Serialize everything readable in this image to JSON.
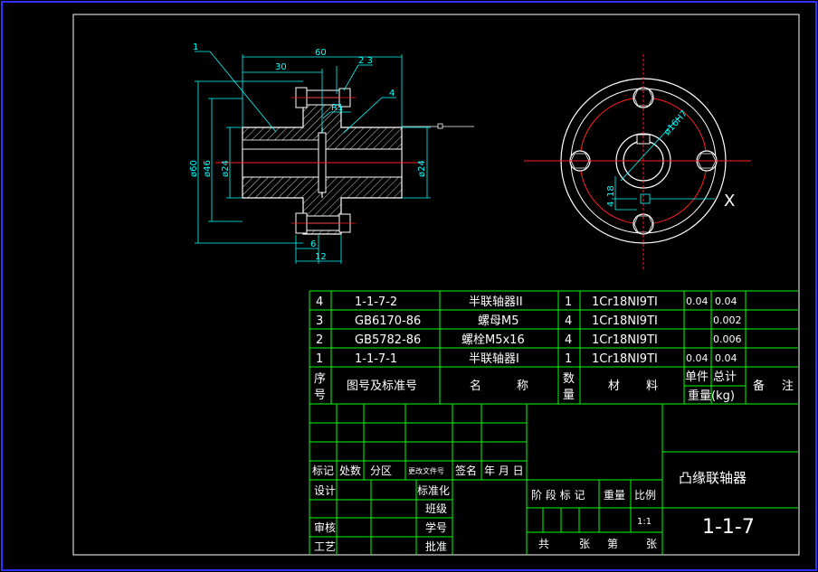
{
  "drawing": {
    "dims": {
      "leader_1": "1",
      "len_60": "60",
      "len_30": "30",
      "leader_23": "2 3",
      "radius_r1": "R1",
      "leader_4": "4",
      "dia_60": "ø60",
      "dia_46": "ø46",
      "dia_24_left": "ø24",
      "dia_24_right": "ø24",
      "len_6": "6",
      "len_12": "12",
      "bore_16h7": "ø16H7",
      "key_18": "18",
      "key_4": "4",
      "section_x": "X"
    }
  },
  "parts_list": {
    "rows": [
      {
        "no": "4",
        "code": "1-1-7-2",
        "name": "半联轴器II",
        "qty": "1",
        "material": "1Cr18NI9TI",
        "unit_w": "0.04",
        "total_w": "0.04"
      },
      {
        "no": "3",
        "code": "GB6170-86",
        "name": "螺母M5",
        "qty": "4",
        "material": "1Cr18NI9TI",
        "unit_w": "",
        "total_w": "0.002"
      },
      {
        "no": "2",
        "code": "GB5782-86",
        "name": "螺栓M5x16",
        "qty": "4",
        "material": "1Cr18NI9TI",
        "unit_w": "",
        "total_w": "0.006"
      },
      {
        "no": "1",
        "code": "1-1-7-1",
        "name": "半联轴器I",
        "qty": "1",
        "material": "1Cr18NI9TI",
        "unit_w": "0.04",
        "total_w": "0.04"
      }
    ],
    "header": {
      "no_1": "序",
      "no_2": "号",
      "code": "图号及标准号",
      "name_1": "名",
      "name_2": "称",
      "qty_1": "数",
      "qty_2": "量",
      "mat_1": "材",
      "mat_2": "料",
      "unit": "单件",
      "total": "总计",
      "weight": "重量(kg)",
      "remark_1": "备",
      "remark_2": "注"
    }
  },
  "title_block": {
    "mark": "标记",
    "count": "处数",
    "zone": "分区",
    "change_doc": "更改文件号",
    "sign": "签名",
    "date": "年 月 日",
    "design": "设计",
    "standard": "标准化",
    "class": "班级",
    "review": "审核",
    "student_no": "学号",
    "process": "工艺",
    "approve": "批准",
    "stage_mark": "阶 段 标 记",
    "weight": "重量",
    "scale": "比例",
    "scale_value": "1:1",
    "sheets_total": "共",
    "sheets_unit": "张",
    "sheet_no": "第",
    "sheet_unit": "张",
    "drawing_title": "凸缘联轴器",
    "drawing_no": "1-1-7"
  }
}
